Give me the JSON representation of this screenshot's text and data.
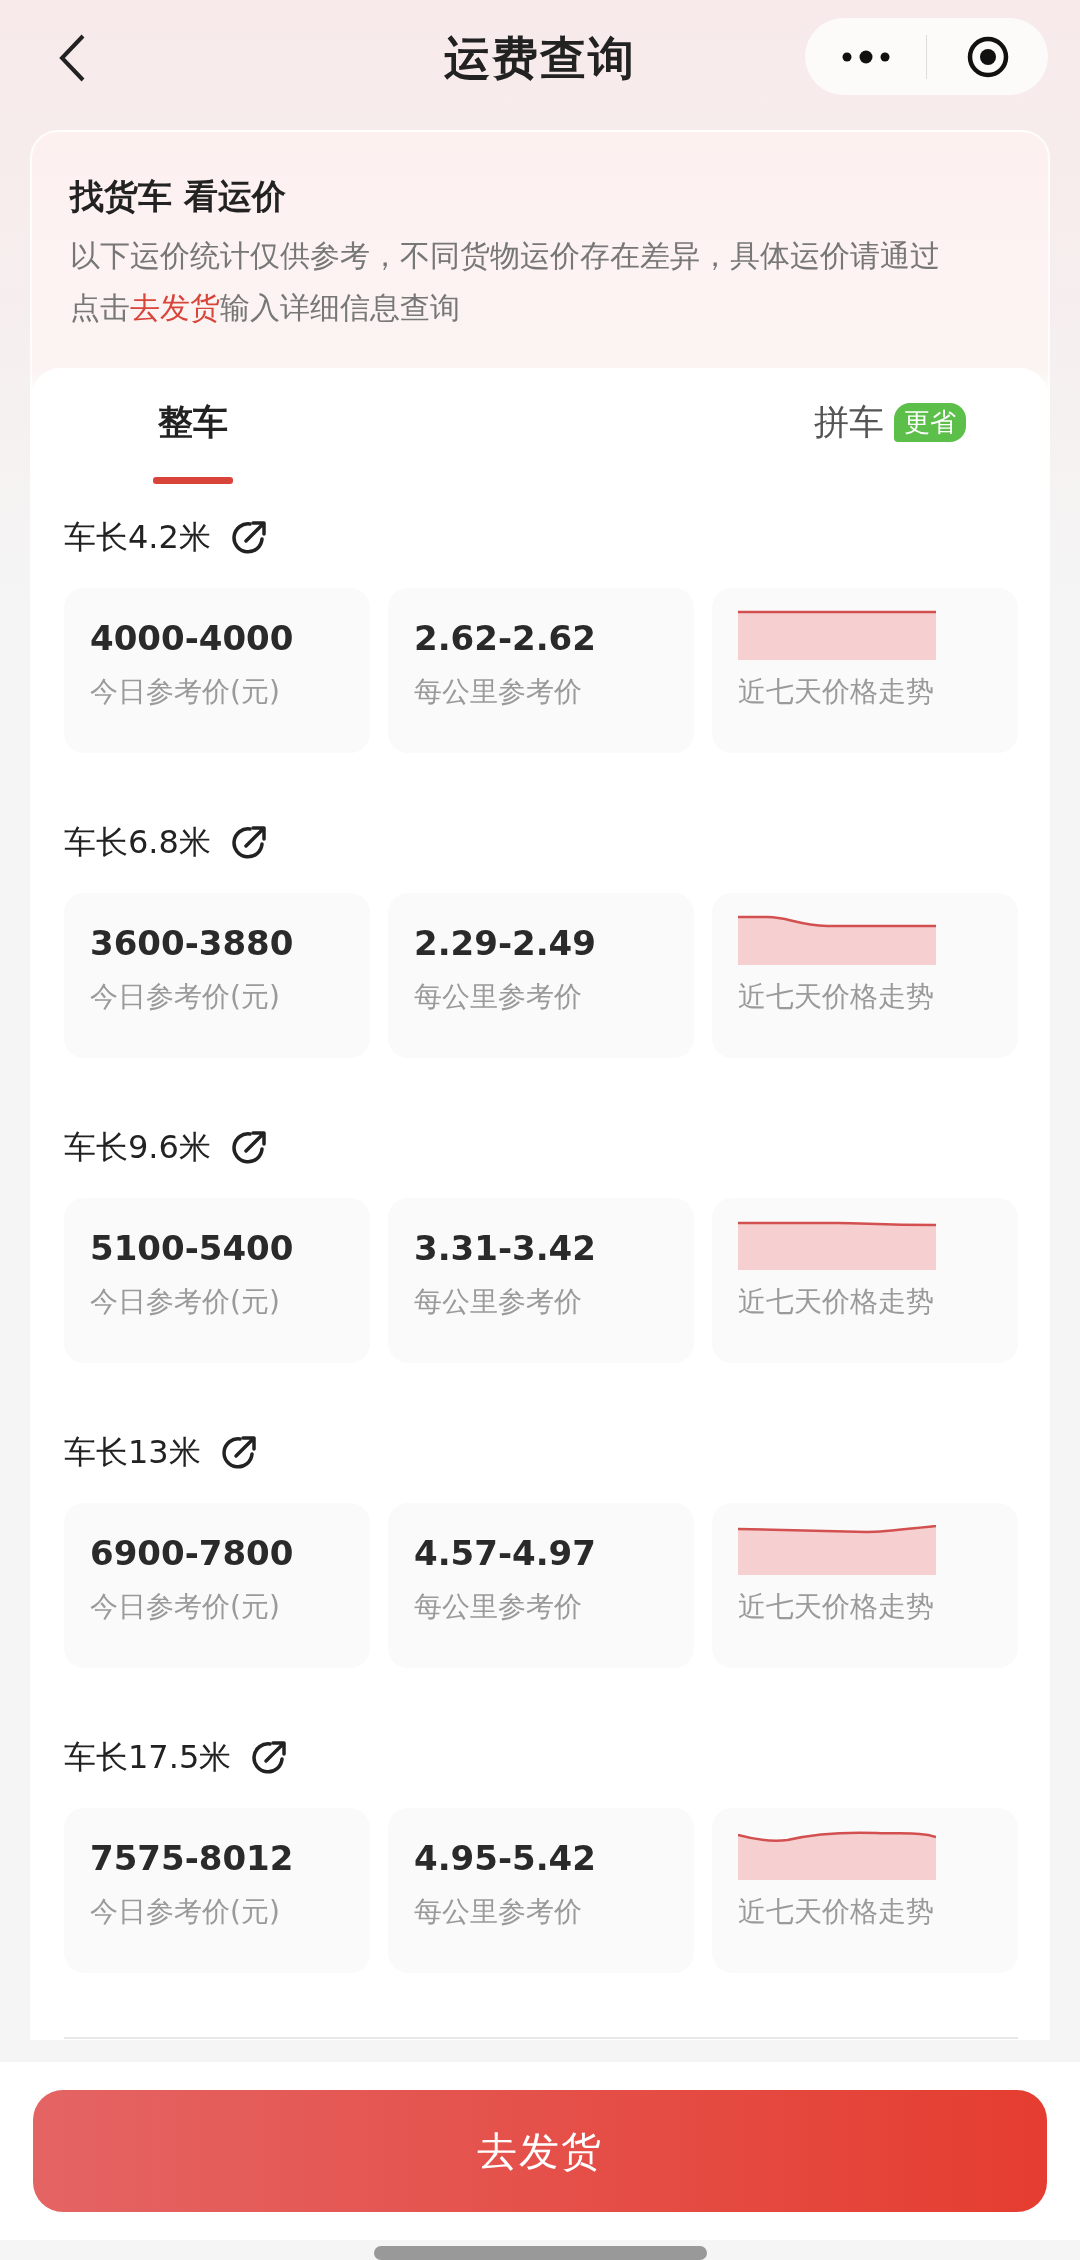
{
  "nav": {
    "title": "运费查询"
  },
  "intro": {
    "heading": "找货车 看运价",
    "description": [
      {
        "kind": "plain",
        "text": "以下运价统计仅供参考，不同货物运价存在差异，具体运价请通过点击"
      },
      {
        "kind": "link",
        "text": "去发货"
      },
      {
        "kind": "plain",
        "text": "输入详细信息查询"
      }
    ]
  },
  "tabs": [
    {
      "label": "整车",
      "selected": true
    },
    {
      "label": "拼车",
      "selected": false,
      "badge": "更省"
    }
  ],
  "trucks": [
    {
      "length": "车长4.2米",
      "price": "4000-4000",
      "price_label": "今日参考价(元)",
      "per_km": "2.62-2.62",
      "per_km_label": "每公里参考价",
      "trend_label": "近七天价格走势"
    },
    {
      "length": "车长6.8米",
      "price": "3600-3880",
      "price_label": "今日参考价(元)",
      "per_km": "2.29-2.49",
      "per_km_label": "每公里参考价",
      "trend_label": "近七天价格走势"
    },
    {
      "length": "车长9.6米",
      "price": "5100-5400",
      "price_label": "今日参考价(元)",
      "per_km": "3.31-3.42",
      "per_km_label": "每公里参考价",
      "trend_label": "近七天价格走势"
    },
    {
      "length": "车长13米",
      "price": "6900-7800",
      "price_label": "今日参考价(元)",
      "per_km": "4.57-4.97",
      "per_km_label": "每公里参考价",
      "trend_label": "近七天价格走势"
    },
    {
      "length": "车长17.5米",
      "price": "7575-8012",
      "price_label": "今日参考价(元)",
      "per_km": "4.95-5.42",
      "per_km_label": "每公里参考价",
      "trend_label": "近七天价格走势"
    }
  ],
  "button": {
    "label": "去发货"
  }
}
